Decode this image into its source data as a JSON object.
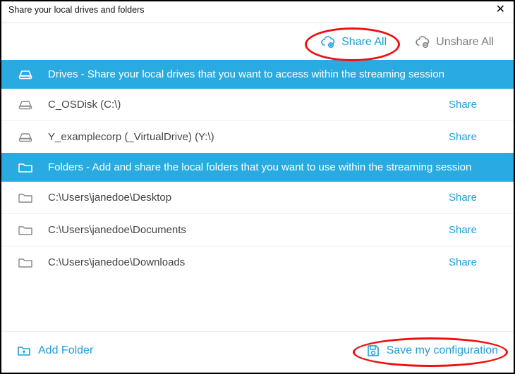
{
  "window": {
    "title": "Share your local drives and folders"
  },
  "topActions": {
    "shareAll": "Share All",
    "unshareAll": "Unshare All"
  },
  "sections": {
    "drives": {
      "header": "Drives - Share your local drives that you want to access within the streaming session",
      "items": [
        {
          "label": "C_OSDisk (C:\\)",
          "action": "Share"
        },
        {
          "label": "Y_examplecorp (_VirtualDrive) (Y:\\)",
          "action": "Share"
        }
      ]
    },
    "folders": {
      "header": "Folders - Add and share the local folders that you want to use within the streaming session",
      "items": [
        {
          "label": "C:\\Users\\janedoe\\Desktop",
          "action": "Share"
        },
        {
          "label": "C:\\Users\\janedoe\\Documents",
          "action": "Share"
        },
        {
          "label": "C:\\Users\\janedoe\\Downloads",
          "action": "Share"
        }
      ]
    }
  },
  "bottom": {
    "addFolder": "Add Folder",
    "save": "Save my configuration"
  },
  "colors": {
    "accent": "#1f9ed8",
    "sectionBg": "#29abe2",
    "muted": "#7d7d7d",
    "highlight": "#e11"
  }
}
